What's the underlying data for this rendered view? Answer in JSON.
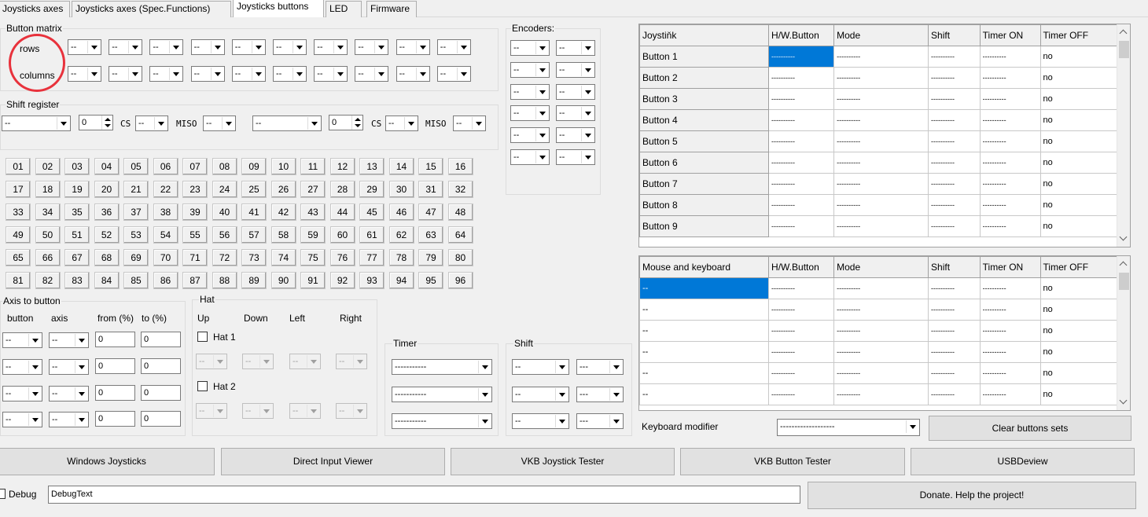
{
  "tabs": [
    "Joysticks axes",
    "Joysticks axes (Spec.Functions)",
    "Joysticks buttons",
    "LED",
    "Firmware"
  ],
  "active_tab": "Joysticks buttons",
  "button_matrix": {
    "title": "Button matrix",
    "rows_label": "rows",
    "columns_label": "columns",
    "cell_value": "--"
  },
  "encoders": {
    "title": "Encoders:",
    "value": "--"
  },
  "shift_register": {
    "title": "Shift register",
    "reg1": {
      "pin": "--",
      "count": "0",
      "cs_label": "CS",
      "cs": "--",
      "miso_label": "MISO",
      "miso": "--"
    },
    "reg2": {
      "pin": "--",
      "count": "0",
      "cs_label": "CS",
      "cs": "--",
      "miso_label": "MISO",
      "miso": "--"
    }
  },
  "button_numbers": [
    "01",
    "02",
    "03",
    "04",
    "05",
    "06",
    "07",
    "08",
    "09",
    "10",
    "11",
    "12",
    "13",
    "14",
    "15",
    "16",
    "17",
    "18",
    "19",
    "20",
    "21",
    "22",
    "23",
    "24",
    "25",
    "26",
    "27",
    "28",
    "29",
    "30",
    "31",
    "32",
    "33",
    "34",
    "35",
    "36",
    "37",
    "38",
    "39",
    "40",
    "41",
    "42",
    "43",
    "44",
    "45",
    "46",
    "47",
    "48",
    "49",
    "50",
    "51",
    "52",
    "53",
    "54",
    "55",
    "56",
    "57",
    "58",
    "59",
    "60",
    "61",
    "62",
    "63",
    "64",
    "65",
    "66",
    "67",
    "68",
    "69",
    "70",
    "71",
    "72",
    "73",
    "74",
    "75",
    "76",
    "77",
    "78",
    "79",
    "80",
    "81",
    "82",
    "83",
    "84",
    "85",
    "86",
    "87",
    "88",
    "89",
    "90",
    "91",
    "92",
    "93",
    "94",
    "95",
    "96"
  ],
  "axis_to_button": {
    "title": "Axis to button",
    "headers": [
      "button",
      "axis",
      "from (%)",
      "to (%)"
    ],
    "rows": [
      {
        "button": "--",
        "axis": "--",
        "from": "0",
        "to": "0"
      },
      {
        "button": "--",
        "axis": "--",
        "from": "0",
        "to": "0"
      },
      {
        "button": "--",
        "axis": "--",
        "from": "0",
        "to": "0"
      },
      {
        "button": "--",
        "axis": "--",
        "from": "0",
        "to": "0"
      }
    ]
  },
  "hat": {
    "title": "Hat",
    "headers": [
      "Up",
      "Down",
      "Left",
      "Right"
    ],
    "hat1_label": "Hat 1",
    "hat2_label": "Hat 2",
    "value": "--"
  },
  "timer": {
    "title": "Timer",
    "values": [
      "-----------",
      "-----------",
      "-----------"
    ]
  },
  "shift": {
    "title": "Shift",
    "values": [
      [
        "--",
        "---"
      ],
      [
        "--",
        "---"
      ],
      [
        "--",
        "---"
      ]
    ]
  },
  "joystick_grid": {
    "headers": [
      "Joystiňk",
      "H/W.Button",
      "Mode",
      "Shift",
      "Timer ON",
      "Timer OFF"
    ],
    "rows": [
      [
        "Button 1",
        "----------",
        "----------",
        "----------",
        "----------",
        "no"
      ],
      [
        "Button 2",
        "----------",
        "----------",
        "----------",
        "----------",
        "no"
      ],
      [
        "Button 3",
        "----------",
        "----------",
        "----------",
        "----------",
        "no"
      ],
      [
        "Button 4",
        "----------",
        "----------",
        "----------",
        "----------",
        "no"
      ],
      [
        "Button 5",
        "----------",
        "----------",
        "----------",
        "----------",
        "no"
      ],
      [
        "Button 6",
        "----------",
        "----------",
        "----------",
        "----------",
        "no"
      ],
      [
        "Button 7",
        "----------",
        "----------",
        "----------",
        "----------",
        "no"
      ],
      [
        "Button 8",
        "----------",
        "----------",
        "----------",
        "----------",
        "no"
      ],
      [
        "Button 9",
        "----------",
        "----------",
        "----------",
        "----------",
        "no"
      ]
    ]
  },
  "mouse_keyboard_grid": {
    "headers": [
      "Mouse and keyboard",
      "H/W.Button",
      "Mode",
      "Shift",
      "Timer ON",
      "Timer OFF"
    ],
    "rows": [
      [
        "--",
        "----------",
        "----------",
        "----------",
        "----------",
        "no"
      ],
      [
        "--",
        "----------",
        "----------",
        "----------",
        "----------",
        "no"
      ],
      [
        "--",
        "----------",
        "----------",
        "----------",
        "----------",
        "no"
      ],
      [
        "--",
        "----------",
        "----------",
        "----------",
        "----------",
        "no"
      ],
      [
        "--",
        "----------",
        "----------",
        "----------",
        "----------",
        "no"
      ],
      [
        "--",
        "----------",
        "----------",
        "----------",
        "----------",
        "no"
      ]
    ]
  },
  "keyboard_modifier": {
    "label": "Keyboard modifier",
    "value": "-------------------"
  },
  "clear_button": "Clear buttons sets",
  "bottom_buttons": [
    "Windows Joysticks",
    "Direct Input Viewer",
    "VKB Joystick Tester",
    "VKB Button Tester",
    "USBDeview"
  ],
  "debug": {
    "label": "Debug",
    "value": "DebugText"
  },
  "donate_button": "Donate. Help the project!",
  "colors": {
    "selection": "#0078d7",
    "annotation": "#e8323c",
    "background": "#f0f0f0"
  }
}
